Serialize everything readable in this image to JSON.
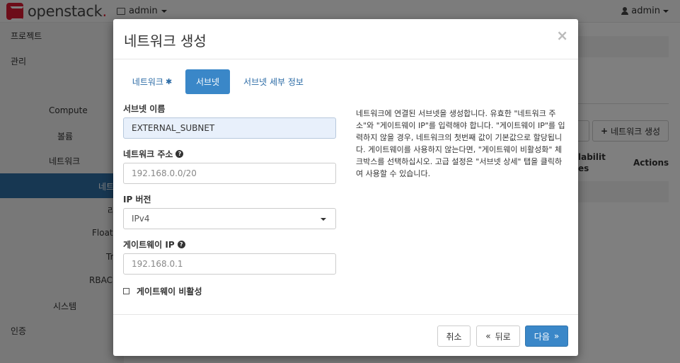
{
  "navbar": {
    "logo_text": "openstack",
    "logo_dot": ".",
    "project_label": "admin",
    "user_label": "admin"
  },
  "sidebar": {
    "items": [
      {
        "label": "프로젝트"
      },
      {
        "label": "관리"
      },
      {
        "label": "Compute"
      },
      {
        "label": "볼륨"
      },
      {
        "label": "네트워크"
      },
      {
        "label": "네트"
      },
      {
        "label": "라"
      },
      {
        "label": "Floati"
      },
      {
        "label": "Tr"
      },
      {
        "label": "RBAC"
      },
      {
        "label": "시스템"
      },
      {
        "label": "인증"
      }
    ]
  },
  "background": {
    "create_network_button": "네트워크 생성",
    "col_availability_1": "labilit",
    "col_availability_2": "es",
    "col_actions": "Actions"
  },
  "modal": {
    "title": "네트워크 생성",
    "close_symbol": "×",
    "tabs": [
      {
        "label": "네트워크",
        "required_mark": "✱"
      },
      {
        "label": "서브넷"
      },
      {
        "label": "서브넷 세부 정보"
      }
    ],
    "fields": {
      "subnet_name": {
        "label": "서브넷 이름",
        "value": "EXTERNAL_SUBNET"
      },
      "network_address": {
        "label": "네트워크 주소",
        "placeholder": "192.168.0.0/20"
      },
      "ip_version": {
        "label": "IP 버전",
        "value": "IPv4"
      },
      "gateway_ip": {
        "label": "게이트웨이 IP",
        "placeholder": "192.168.0.1"
      },
      "disable_gateway": {
        "label": "게이트웨이 비활성"
      }
    },
    "help_text": "네트워크에 연결된 서브넷을 생성합니다. 유효한 \"네트워크 주소\"와 \"게이트웨이 IP\"를 입력해야 합니다. \"게이트웨이 IP\"를 입력하지 않을 경우, 네트워크의 첫번째 값이 기본값으로 할당됩니다. 게이트웨이를 사용하지 않는다면, \"게이트웨이 비활성화\" 체크박스를 선택하십시오. 고급 설정은 \"서브넷 상세\" 탭을 클릭하여 사용할 수 있습니다.",
    "footer": {
      "cancel_label": "취소",
      "back_label": "뒤로",
      "back_icon": "«",
      "next_label": "다음",
      "next_icon": "»"
    }
  },
  "colors": {
    "primary": "#3a87c8",
    "link": "#2a6aa5",
    "brand": "#da1a32",
    "sidebar_active": "#2f6ea5"
  }
}
